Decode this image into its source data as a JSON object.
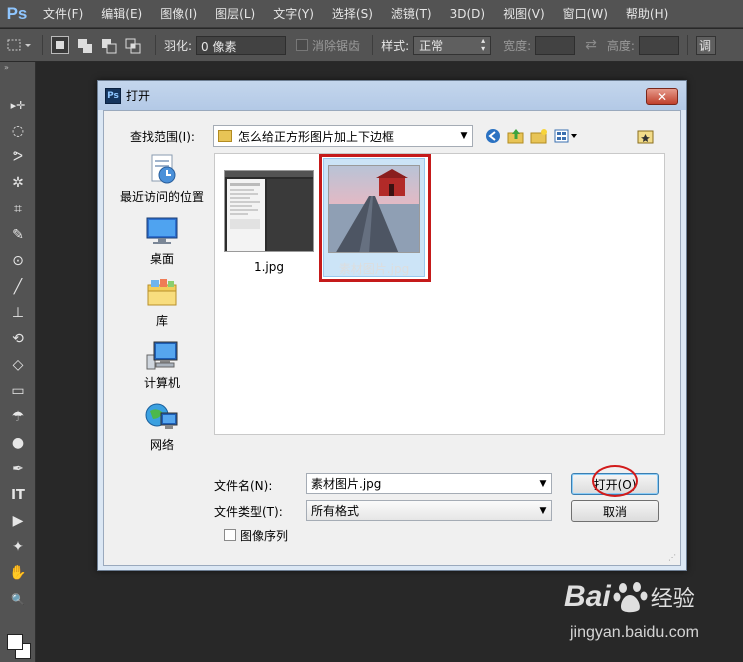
{
  "app": {
    "logo": "Ps",
    "menu": [
      "文件(F)",
      "编辑(E)",
      "图像(I)",
      "图层(L)",
      "文字(Y)",
      "选择(S)",
      "滤镜(T)",
      "3D(D)",
      "视图(V)",
      "窗口(W)",
      "帮助(H)"
    ]
  },
  "options_bar": {
    "feather_label": "羽化:",
    "feather_value": "0 像素",
    "antialias_label": "消除锯齿",
    "style_label": "样式:",
    "style_value": "正常",
    "width_label": "宽度:",
    "height_label": "高度:",
    "overflow_label": "调"
  },
  "toolbar": {
    "grip": "»",
    "tools": [
      "move-tool-icon",
      "marquee-tool-icon",
      "lasso-tool-icon",
      "magic-wand-icon",
      "crop-tool-icon",
      "eyedropper-icon",
      "healing-brush-icon",
      "brush-tool-icon",
      "stamp-tool-icon",
      "history-brush-icon",
      "eraser-icon",
      "gradient-tool-icon",
      "blur-tool-icon",
      "dodge-tool-icon",
      "pen-tool-icon",
      "type-tool-icon",
      "path-select-icon",
      "shape-tool-icon",
      "hand-tool-icon",
      "zoom-tool-icon"
    ],
    "glyphs": [
      "▸✛",
      "◌",
      "ᕗ",
      "✲",
      "⌗",
      "✎",
      "⊙",
      "╱",
      "⊥",
      "⟲",
      "◇",
      "▭",
      "☂",
      "●",
      "✒",
      "IT",
      "▶",
      "✦",
      "✋",
      "🔍"
    ],
    "fg_color": "#ffffff",
    "bg_color": "#ffffff"
  },
  "dialog": {
    "title": "打开",
    "close_glyph": "✕",
    "lookin_label": "查找范围(I):",
    "lookin_value": "怎么给正方形图片加上下边框",
    "places": [
      {
        "label": "最近访问的位置",
        "icon": "recent-places-icon"
      },
      {
        "label": "桌面",
        "icon": "desktop-icon"
      },
      {
        "label": "库",
        "icon": "libraries-icon"
      },
      {
        "label": "计算机",
        "icon": "computer-icon"
      },
      {
        "label": "网络",
        "icon": "network-icon"
      }
    ],
    "files": [
      {
        "name": "1.jpg"
      },
      {
        "name": "素材图片.jpg"
      }
    ],
    "filename_label": "文件名(N):",
    "filename_value": "素材图片.jpg",
    "filetype_label": "文件类型(T):",
    "filetype_value": "所有格式",
    "open_button": "打开(O)",
    "cancel_button": "取消",
    "image_sequence_label": "图像序列"
  },
  "watermark": {
    "brand": "Bai",
    "brand_suffix": "经验",
    "url": "jingyan.baidu.com"
  }
}
